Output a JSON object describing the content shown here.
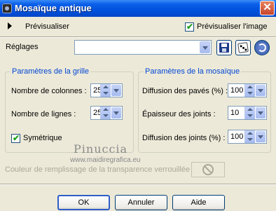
{
  "window": {
    "title": "Mosaïque antique",
    "close_label": "✕"
  },
  "preview": {
    "label": "Prévisualiser",
    "image_label": "Prévisualiser l'image",
    "image_checked": true
  },
  "reglages": {
    "label": "Réglages",
    "value": ""
  },
  "grid": {
    "legend": "Paramètres de la grille",
    "columns_label": "Nombre de colonnes :",
    "columns_value": "25",
    "rows_label": "Nombre de lignes :",
    "rows_value": "25",
    "symmetric_label": "Symétrique",
    "symmetric_checked": true
  },
  "mosaic": {
    "legend": "Paramètres de la mosaïque",
    "tile_diffusion_label": "Diffusion des pavés (%) :",
    "tile_diffusion_value": "100",
    "joint_thickness_label": "Épaisseur des joints :",
    "joint_thickness_value": "10",
    "joint_diffusion_label": "Diffusion des joints (%) :",
    "joint_diffusion_value": "100"
  },
  "watermark": {
    "name": "Pinuccia",
    "url": "www.maidiregrafica.eu"
  },
  "transparency": {
    "label": "Couleur de remplissage de la transparence verrouillée :"
  },
  "buttons": {
    "ok": "OK",
    "cancel": "Annuler",
    "help": "Aide"
  },
  "icons": {
    "app": "mosaic-app-icon",
    "arrow": "triangle-right-icon",
    "save": "floppy-disk-icon",
    "random": "dice-icon",
    "reset": "reset-icon",
    "no_color": "no-color-icon"
  },
  "colors": {
    "title_bar": "#0052de",
    "legend_text": "#0046d5",
    "dialog_bg": "#ece9d8"
  }
}
